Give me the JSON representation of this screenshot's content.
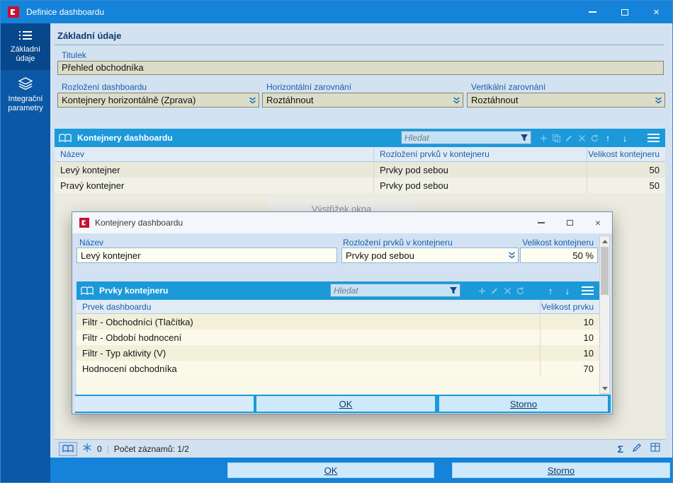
{
  "window": {
    "title": "Definice dashboardu"
  },
  "icons": {
    "minimize": "—",
    "maximize": "□",
    "close": "×",
    "up": "↑",
    "down": "↓",
    "sigma": "Σ",
    "separator": "|"
  },
  "sidebar": {
    "items": [
      {
        "label": "Základní údaje"
      },
      {
        "label": "Integrační parametry"
      }
    ]
  },
  "form": {
    "section_title": "Základní údaje",
    "titulek": {
      "label": "Titulek",
      "value": "Přehled obchodníka"
    },
    "rozlozeni": {
      "label": "Rozložení dashboardu",
      "value": "Kontejnery horizontálně (Zprava)"
    },
    "horizontalni": {
      "label": "Horizontální zarovnání",
      "value": "Roztáhnout"
    },
    "vertikalni": {
      "label": "Vertikální zarovnání",
      "value": "Roztáhnout"
    }
  },
  "grid": {
    "title": "Kontejnery dashboardu",
    "search_placeholder": "Hledat",
    "columns": [
      "Název",
      "Rozložení prvků v kontejneru",
      "Velikost kontejneru"
    ],
    "rows": [
      {
        "nazev": "Levý kontejner",
        "rozlozeni": "Prvky pod sebou",
        "velikost": "50"
      },
      {
        "nazev": "Pravý kontejner",
        "rozlozeni": "Prvky pod sebou",
        "velikost": "50"
      }
    ]
  },
  "status": {
    "aux_count": "0",
    "records": "Počet záznamů: 1/2"
  },
  "footer": {
    "ok": "OK",
    "storno": "Storno"
  },
  "watermark": "Výstřižek okna",
  "modal": {
    "title": "Kontejnery dashboardu",
    "fields": {
      "nazev": {
        "label": "Název",
        "value": "Levý kontejner"
      },
      "rozlozeni": {
        "label": "Rozložení prvků v kontejneru",
        "value": "Prvky pod sebou"
      },
      "velikost": {
        "label": "Velikost kontejneru",
        "value": "50 %"
      }
    },
    "grid": {
      "title": "Prvky kontejneru",
      "search_placeholder": "Hledat",
      "columns": [
        "Prvek dashboardu",
        "Velikost prvku"
      ],
      "rows": [
        {
          "prvek": "Filtr - Obchodníci (Tlačítka)",
          "velikost": "10"
        },
        {
          "prvek": "Filtr - Období hodnocení",
          "velikost": "10"
        },
        {
          "prvek": "Filtr - Typ aktivity (V)",
          "velikost": "10"
        },
        {
          "prvek": "Hodnocení obchodníka",
          "velikost": "70"
        }
      ]
    },
    "buttons": {
      "ok": "OK",
      "storno": "Storno"
    }
  }
}
